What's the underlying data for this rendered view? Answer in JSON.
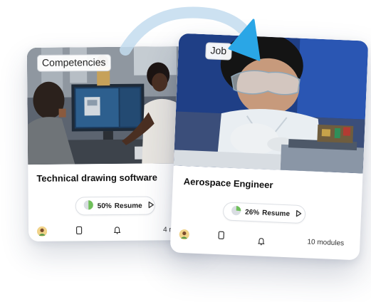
{
  "cards": [
    {
      "tag": "Competencies",
      "title": "Technical drawing software",
      "progress": 50,
      "progress_text": "50%",
      "resume_label": "Resume",
      "modules_text": "4 m"
    },
    {
      "tag": "Job",
      "title": "Aerospace Engineer",
      "progress": 26,
      "progress_text": "26%",
      "resume_label": "Resume",
      "modules_text": "10 modules"
    }
  ],
  "colors": {
    "accent": "#2aa6e6",
    "arc": "#bcd9ee",
    "progress_fill": "#6fbf5a",
    "progress_track": "#d9dde2"
  },
  "icons": {
    "arrow": "arrow-head-icon",
    "play": "play-icon",
    "document": "document-icon",
    "bell": "bell-icon",
    "avatar": "avatar"
  }
}
